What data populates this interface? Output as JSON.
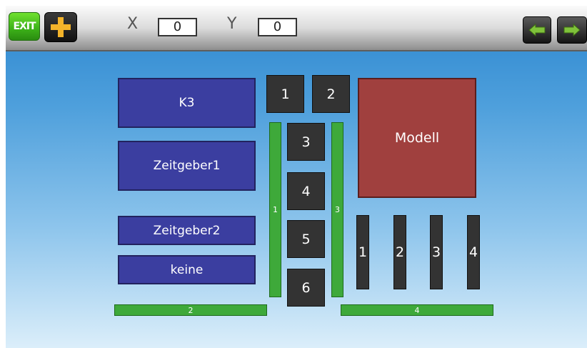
{
  "toolbar": {
    "exit_label": "EXIT",
    "x_label": "X",
    "x_value": "0",
    "y_label": "Y",
    "y_value": "0"
  },
  "layout": {
    "blue_items": [
      "K3",
      "Zeitgeber1",
      "Zeitgeber2",
      "keine"
    ],
    "dark_boxes": [
      "1",
      "2",
      "3",
      "4",
      "5",
      "6"
    ],
    "vertical_bars": [
      "1",
      "3"
    ],
    "horizontal_bars": [
      "2",
      "4"
    ],
    "model_label": "Modell",
    "right_bars": [
      "1",
      "2",
      "3",
      "4"
    ]
  },
  "colors": {
    "blue_item": "#3b3ea0",
    "dark_box": "#333333",
    "green_bar": "#3ea93a",
    "model_red": "#a0403e"
  }
}
